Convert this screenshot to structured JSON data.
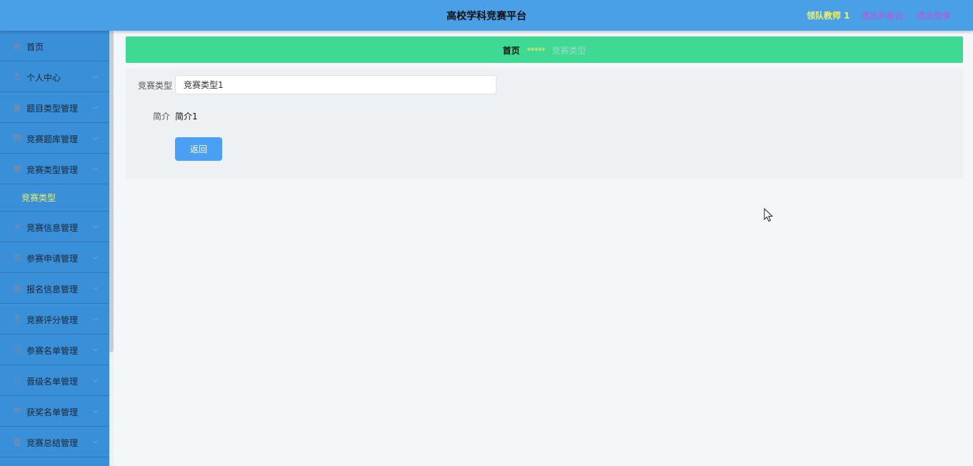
{
  "header": {
    "title": "高校学科竞赛平台",
    "user_label": "领队教师 1",
    "front_link": "退出到前台",
    "logout_link": "退出登录"
  },
  "sidebar": {
    "items": [
      {
        "label": "首页",
        "icon": "home-icon"
      },
      {
        "label": "个人中心",
        "icon": "user-icon"
      },
      {
        "label": "题目类型管理",
        "icon": "clipboard-icon"
      },
      {
        "label": "竞赛题库管理",
        "icon": "picture-icon"
      },
      {
        "label": "竞赛类型管理",
        "icon": "monitor-icon",
        "expanded": true,
        "children": [
          {
            "label": "竞赛类型"
          }
        ]
      },
      {
        "label": "竞赛信息管理",
        "icon": "send-icon"
      },
      {
        "label": "参赛申请管理",
        "icon": "list-icon"
      },
      {
        "label": "报名信息管理",
        "icon": "books-icon"
      },
      {
        "label": "竞赛评分管理",
        "icon": "trophy-icon"
      },
      {
        "label": "参赛名单管理",
        "icon": "target-icon"
      },
      {
        "label": "晋级名单管理",
        "icon": "power-icon"
      },
      {
        "label": "获奖名单管理",
        "icon": "flag-icon"
      },
      {
        "label": "竞赛总结管理",
        "icon": "checklist-icon"
      }
    ]
  },
  "breadcrumb": {
    "home": "首页",
    "separator": "*****",
    "current": "竞赛类型"
  },
  "form": {
    "type_label": "竞赛类型",
    "type_value": "竞赛类型1",
    "intro_label": "简介",
    "intro_value": "简介1",
    "back_button": "返回"
  },
  "colors": {
    "header_bg": "#4aa0e6",
    "sidebar_bg": "#3a8fd9",
    "breadcrumb_bg": "#3ed993",
    "button_bg": "#4aa0f5",
    "active_submenu_text": "#e8f06b"
  }
}
